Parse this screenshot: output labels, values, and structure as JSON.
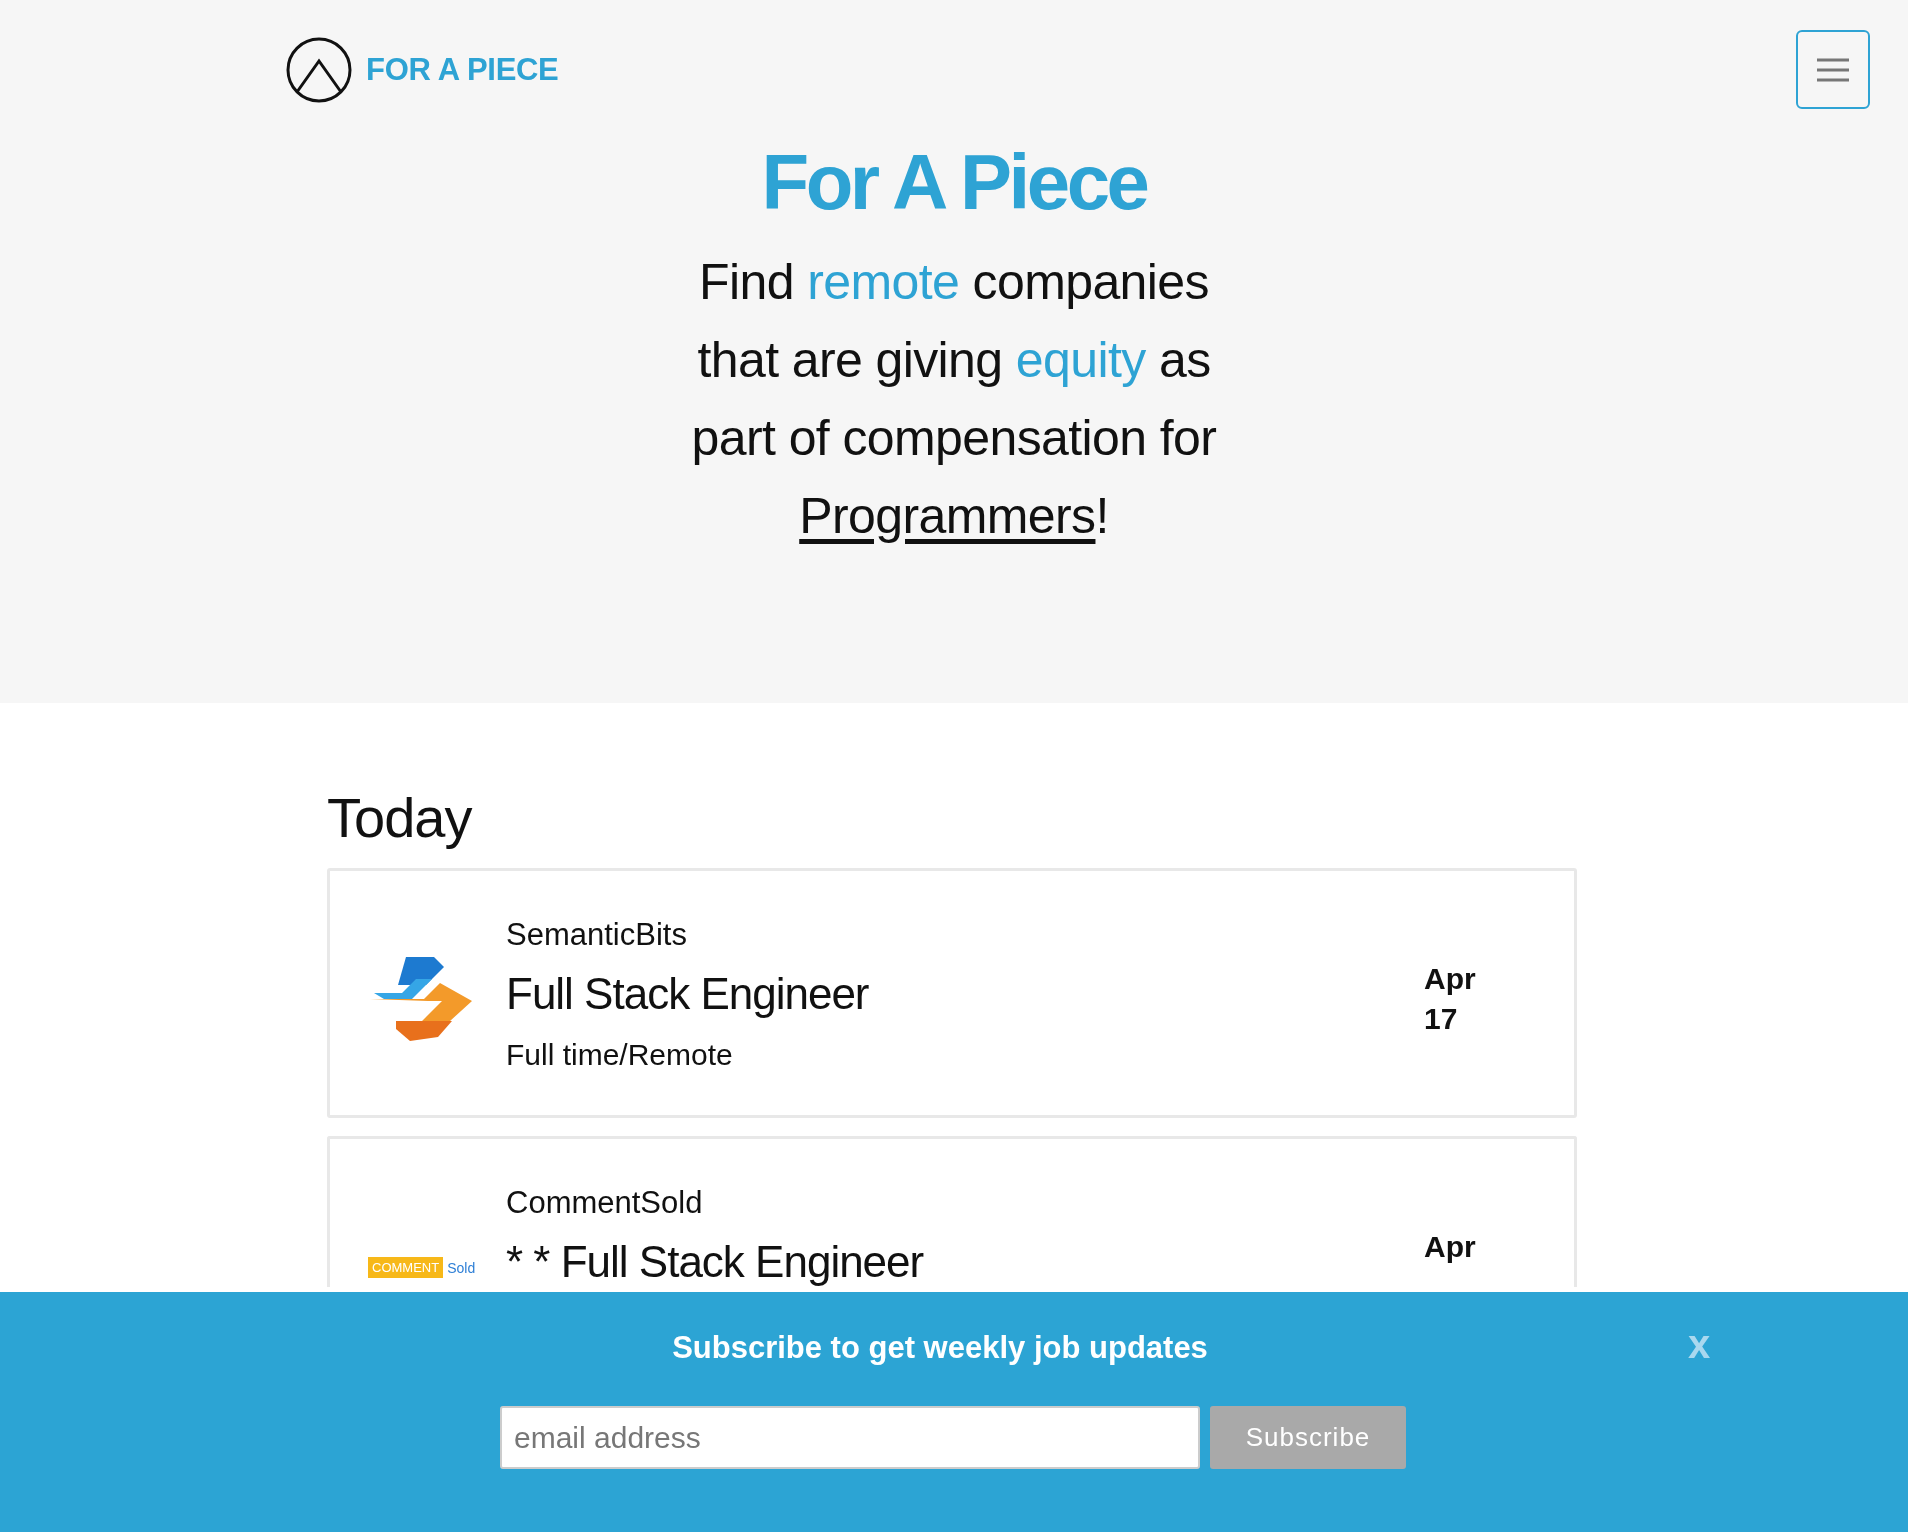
{
  "header": {
    "brand": "FOR A PIECE",
    "menu_button": true
  },
  "hero": {
    "title": "For A Piece",
    "tagline": [
      {
        "kind": "text",
        "text": "Find "
      },
      {
        "kind": "highlight",
        "text": "remote"
      },
      {
        "kind": "text",
        "text": " companies that are giving "
      },
      {
        "kind": "highlight",
        "text": "equity"
      },
      {
        "kind": "text",
        "text": " as part of compensation for "
      },
      {
        "kind": "link",
        "text": "Programmers"
      },
      {
        "kind": "text",
        "text": "!"
      }
    ]
  },
  "section": {
    "heading": "Today"
  },
  "jobs": [
    {
      "logo": {
        "kind": "semanticbits"
      },
      "company": "SemanticBits",
      "title": "Full Stack Engineer",
      "type": "Full time/Remote",
      "date": "Apr 17"
    },
    {
      "logo": {
        "kind": "commentsold",
        "parts": [
          "COMMENT",
          "Sold"
        ]
      },
      "company": "CommentSold",
      "title": "* * Full Stack Engineer",
      "date": "Apr"
    }
  ],
  "subscribe": {
    "heading": "Subscribe to get weekly job updates",
    "close": "x",
    "placeholder": "email address",
    "button": "Subscribe"
  }
}
